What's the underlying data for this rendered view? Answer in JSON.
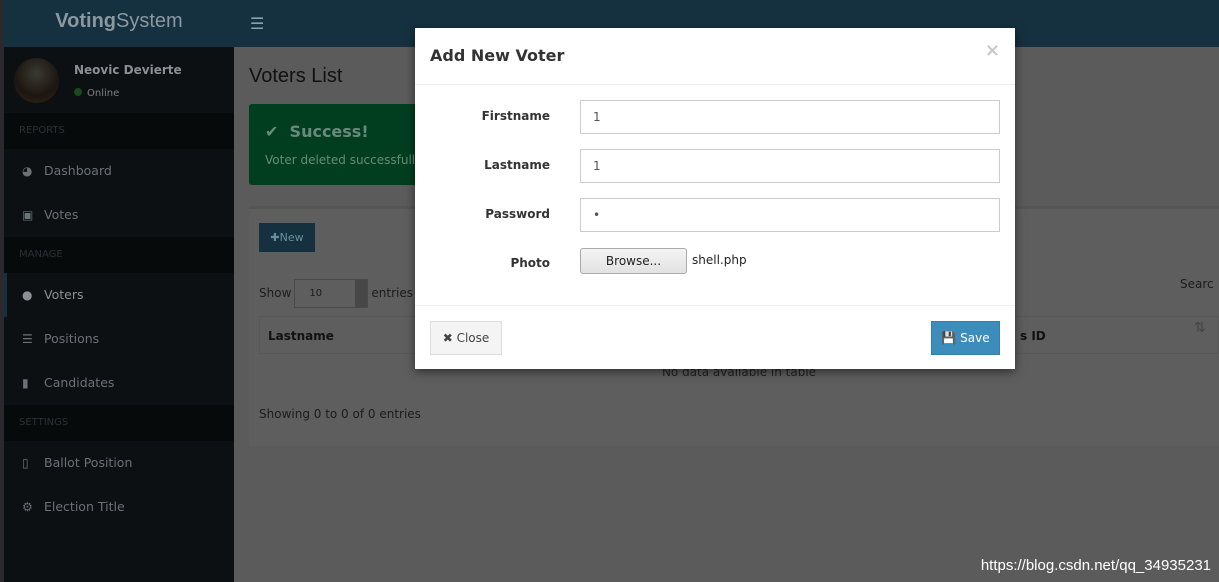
{
  "app": {
    "logo_bold": "Voting",
    "logo_rest": "System",
    "menu_icon": "bars-icon"
  },
  "user": {
    "name": "Neovic Devierte",
    "status": "Online"
  },
  "sidebar": {
    "headers": [
      "REPORTS",
      "MANAGE",
      "SETTINGS"
    ],
    "items": [
      {
        "label": "Dashboard",
        "icon": "dashboard-icon"
      },
      {
        "label": "Votes",
        "icon": "lock-icon"
      },
      {
        "label": "Voters",
        "icon": "users-icon"
      },
      {
        "label": "Positions",
        "icon": "list-icon"
      },
      {
        "label": "Candidates",
        "icon": "id-card-icon"
      },
      {
        "label": "Ballot Position",
        "icon": "file-icon"
      },
      {
        "label": "Election Title",
        "icon": "cog-icon"
      }
    ]
  },
  "page": {
    "title": "Voters List",
    "alert_title": "Success!",
    "alert_message": "Voter deleted successfully",
    "new_label": "New",
    "show_label": "Show",
    "entries_value": "10",
    "entries_label": "entries",
    "search_label": "Searc",
    "col_first": "Lastname",
    "col_last": "s ID",
    "no_data": "No data available in table",
    "info": "Showing 0 to 0 of 0 entries"
  },
  "modal": {
    "title": "Add New Voter",
    "close_x": "×",
    "firstname_label": "Firstname",
    "firstname_value": "1",
    "lastname_label": "Lastname",
    "lastname_value": "1",
    "password_label": "Password",
    "password_value": "1",
    "photo_label": "Photo",
    "browse_label": "Browse...",
    "file_name": "shell.php",
    "close_label": "Close",
    "save_label": "Save"
  },
  "watermark": "https://blog.csdn.net/qq_34935231"
}
